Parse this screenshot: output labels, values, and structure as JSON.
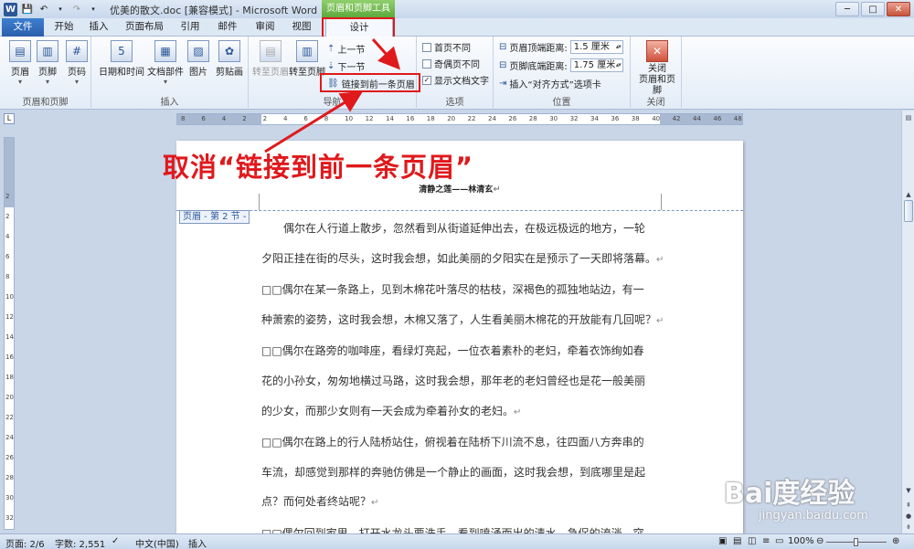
{
  "app": {
    "window_title": "优美的散文.doc [兼容模式] - Microsoft Word",
    "context_group": "页眉和页脚工具"
  },
  "tabs": [
    {
      "label": "文件"
    },
    {
      "label": "开始"
    },
    {
      "label": "插入"
    },
    {
      "label": "页面布局"
    },
    {
      "label": "引用"
    },
    {
      "label": "邮件"
    },
    {
      "label": "审阅"
    },
    {
      "label": "视图"
    },
    {
      "label": "设计"
    }
  ],
  "ribbon": {
    "groups": {
      "header_footer": {
        "label": "页眉和页脚",
        "buttons": [
          "页眉",
          "页脚",
          "页码"
        ]
      },
      "insert": {
        "label": "插入",
        "buttons": [
          "日期和时间",
          "文档部件",
          "图片",
          "剪贴画"
        ]
      },
      "navigation": {
        "label": "导航",
        "goto_header": "转至页眉",
        "goto_footer": "转至页脚",
        "prev": "上一节",
        "next": "下一节",
        "link_prev": "链接到前一条页眉"
      },
      "options": {
        "label": "选项",
        "first_page": "首页不同",
        "odd_even": "奇偶页不同",
        "show_text": "显示文档文字"
      },
      "position": {
        "label": "位置",
        "header_dist_label": "页眉顶端距离:",
        "header_dist_value": "1.5 厘米",
        "footer_dist_label": "页脚底端距离:",
        "footer_dist_value": "1.75 厘米",
        "insert_align_tab": "插入“对齐方式”选项卡"
      },
      "close": {
        "label": "关闭",
        "button": "关闭\n页眉和页脚"
      }
    }
  },
  "ruler_ticks": [
    "8",
    "6",
    "4",
    "2",
    "2",
    "4",
    "6",
    "8",
    "10",
    "12",
    "14",
    "16",
    "18",
    "20",
    "22",
    "24",
    "26",
    "28",
    "30",
    "32",
    "34",
    "36",
    "38",
    "40",
    "42",
    "44",
    "46",
    "48"
  ],
  "vruler_ticks": [
    "2",
    "2",
    "4",
    "6",
    "8",
    "10",
    "12",
    "14",
    "16",
    "18",
    "20",
    "22",
    "24",
    "26",
    "28",
    "30",
    "32"
  ],
  "document": {
    "header_text": "清静之莲——林清玄",
    "section_tag": "页眉 - 第 2 节 -",
    "para_mark": "↵",
    "lines": [
      {
        "indent": true,
        "text": "偶尔在人行道上散步，忽然看到从街道延伸出去，在极远极远的地方，一轮"
      },
      {
        "indent": false,
        "text": "夕阳正挂在街的尽头，这时我会想，如此美丽的夕阳实在是预示了一天即将落幕。",
        "end": true
      },
      {
        "indent": false,
        "text": "□□偶尔在某一条路上，见到木棉花叶落尽的枯枝，深褐色的孤独地站边，有一"
      },
      {
        "indent": false,
        "text": "种萧索的姿势，这时我会想，木棉又落了，人生看美丽木棉花的开放能有几回呢？",
        "end": true
      },
      {
        "indent": false,
        "text": "□□偶尔在路旁的咖啡座，看绿灯亮起，一位衣着素朴的老妇，牵着衣饰绚如春"
      },
      {
        "indent": false,
        "text": "花的小孙女，匆匆地横过马路，这时我会想，那年老的老妇曾经也是花一般美丽"
      },
      {
        "indent": false,
        "text": "的少女，而那少女则有一天会成为牵着孙女的老妇。",
        "end": true
      },
      {
        "indent": false,
        "text": "□□偶尔在路上的行人陆桥站住，俯视着在陆桥下川流不息，往四面八方奔串的"
      },
      {
        "indent": false,
        "text": "车流，却感觉到那样的奔驰仿佛是一个静止的画面，这时我会想，到底哪里是起"
      },
      {
        "indent": false,
        "text": "点？而何处者终站呢？",
        "end": true
      },
      {
        "indent": false,
        "text": "□□偶尔回到家里，打开水龙头要洗手，看到喷涌而出的清水，急促的流淌，突"
      }
    ]
  },
  "status": {
    "page": "页面: 2/6",
    "words": "字数: 2,551",
    "lang": "中文(中国)",
    "mode": "插入",
    "zoom": "100%"
  },
  "annotation": {
    "text": "取消“链接到前一条页眉”"
  },
  "watermark": {
    "brand": "Bai度经验",
    "url": "jingyan.baidu.com"
  },
  "colors": {
    "accent": "#2b5797",
    "annotation_red": "#e0191c",
    "context_green": "#5aa83a"
  }
}
